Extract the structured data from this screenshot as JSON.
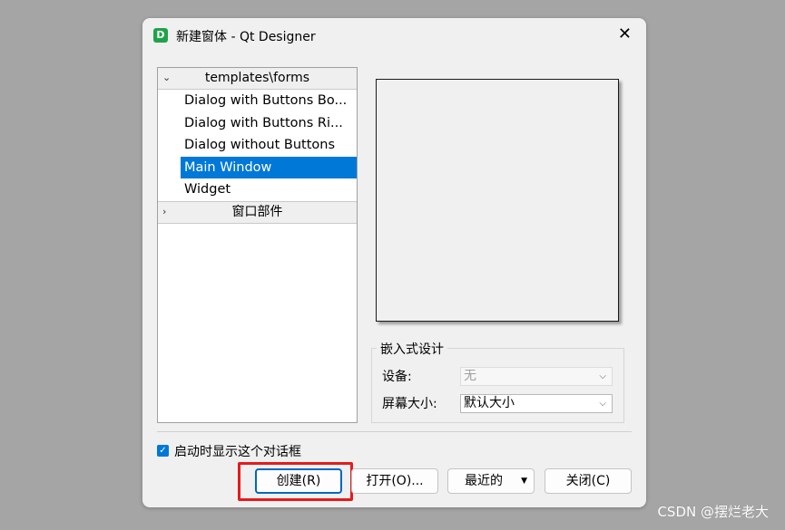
{
  "window": {
    "icon_letter": "D",
    "title": "新建窗体 - Qt Designer",
    "close_glyph": "✕"
  },
  "tree": {
    "categories": [
      {
        "label": "templates\\forms",
        "expanded": true
      },
      {
        "label": "窗口部件",
        "expanded": false
      }
    ],
    "items": [
      "Dialog with Buttons Bo...",
      "Dialog with Buttons Ri...",
      "Dialog without Buttons",
      "Main Window",
      "Widget"
    ],
    "selected_index": 3
  },
  "embedded": {
    "group_title": "嵌入式设计",
    "device_label": "设备:",
    "device_value": "无",
    "screen_label": "屏幕大小:",
    "screen_value": "默认大小"
  },
  "options": {
    "show_on_startup_label": "启动时显示这个对话框",
    "show_on_startup_checked": true
  },
  "buttons": {
    "create": "创建(R)",
    "open": "打开(O)...",
    "recent": "最近的",
    "close": "关闭(C)"
  },
  "icons": {
    "expand_arrow": "⌄",
    "collapse_arrow": "›",
    "combo_chevron": "⌵",
    "dropdown": "▼",
    "check": "✓"
  },
  "colors": {
    "selection": "#0078d7",
    "highlight_box": "#e8191b",
    "app_icon": "#1fa34a"
  },
  "watermark": "CSDN @摆烂老大"
}
